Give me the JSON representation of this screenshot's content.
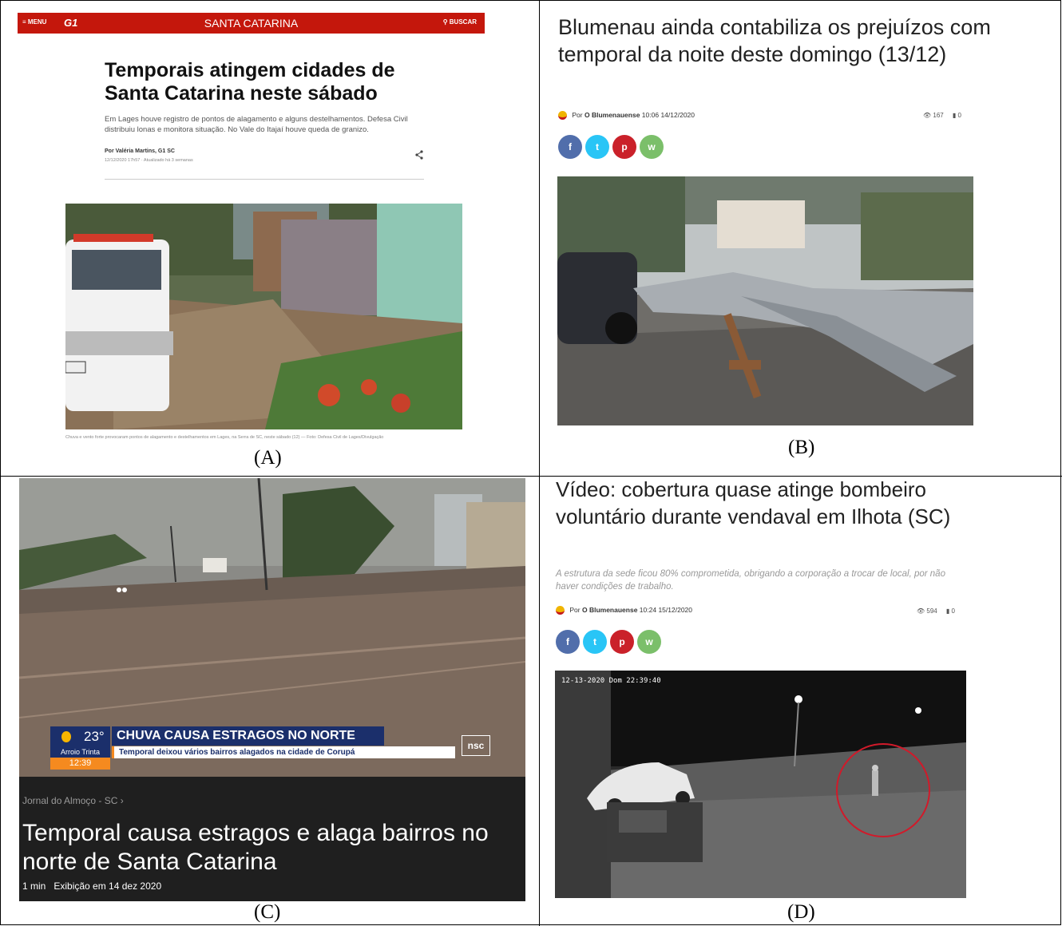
{
  "panel_a": {
    "caption": "(A)",
    "topbar": {
      "menu": "≡ MENU",
      "logo": "G1",
      "section": "SANTA CATARINA",
      "search": "⚲ BUSCAR"
    },
    "headline": "Temporais atingem cidades de Santa Catarina neste sábado",
    "subtitle": "Em Lages houve registro de pontos de alagamento e alguns destelhamentos. Defesa Civil distribuiu lonas e monitora situação. No Vale do Itajaí houve queda de granizo.",
    "author": "Por Valéria Martins, G1 SC",
    "date": "12/12/2020 17h57 · Atualizado há 3 semanas",
    "share_icon": "share-icon",
    "photo_caption": "Chuva e vento forte provocaram pontos de alagamento e destelhamentos em Lages, na Serra de SC, neste sábado (12) — Foto: Defesa Civil de Lages/Divulgação"
  },
  "panel_b": {
    "caption": "(B)",
    "headline": "Blumenau ainda contabiliza os prejuízos com temporal da noite deste domingo (13/12)",
    "by_prefix": "Por",
    "author": "O Blumenauense",
    "time": "10:06",
    "date": "14/12/2020",
    "views": "167",
    "comments": "0",
    "social": [
      "f",
      "t",
      "p",
      "w"
    ]
  },
  "panel_c": {
    "caption": "(C)",
    "temperature": "23°",
    "city": "Arroio Trinta",
    "clock": "12:39",
    "tv_headline": "CHUVA CAUSA ESTRAGOS NO NORTE",
    "tv_ticker": "Temporal deixou vários bairros alagados na cidade de Corupá",
    "channel_logo": "nsc",
    "program": "Jornal do Almoço - SC ›",
    "title": "Temporal causa estragos e alaga bairros no norte de Santa Catarina",
    "duration": "1 min",
    "aired": "Exibição em 14 dez 2020"
  },
  "panel_d": {
    "caption": "(D)",
    "headline": "Vídeo: cobertura quase atinge bombeiro voluntário durante vendaval em Ilhota (SC)",
    "subtitle": "A estrutura da sede ficou 80% comprometida, obrigando a corporação a trocar de local, por não haver condições de trabalho.",
    "by_prefix": "Por",
    "author": "O Blumenauense",
    "time": "10:24",
    "date": "15/12/2020",
    "views": "594",
    "comments": "0",
    "cctv_timestamp": "12-13-2020 Dom 22:39:40",
    "social": [
      "f",
      "t",
      "p",
      "w"
    ]
  }
}
